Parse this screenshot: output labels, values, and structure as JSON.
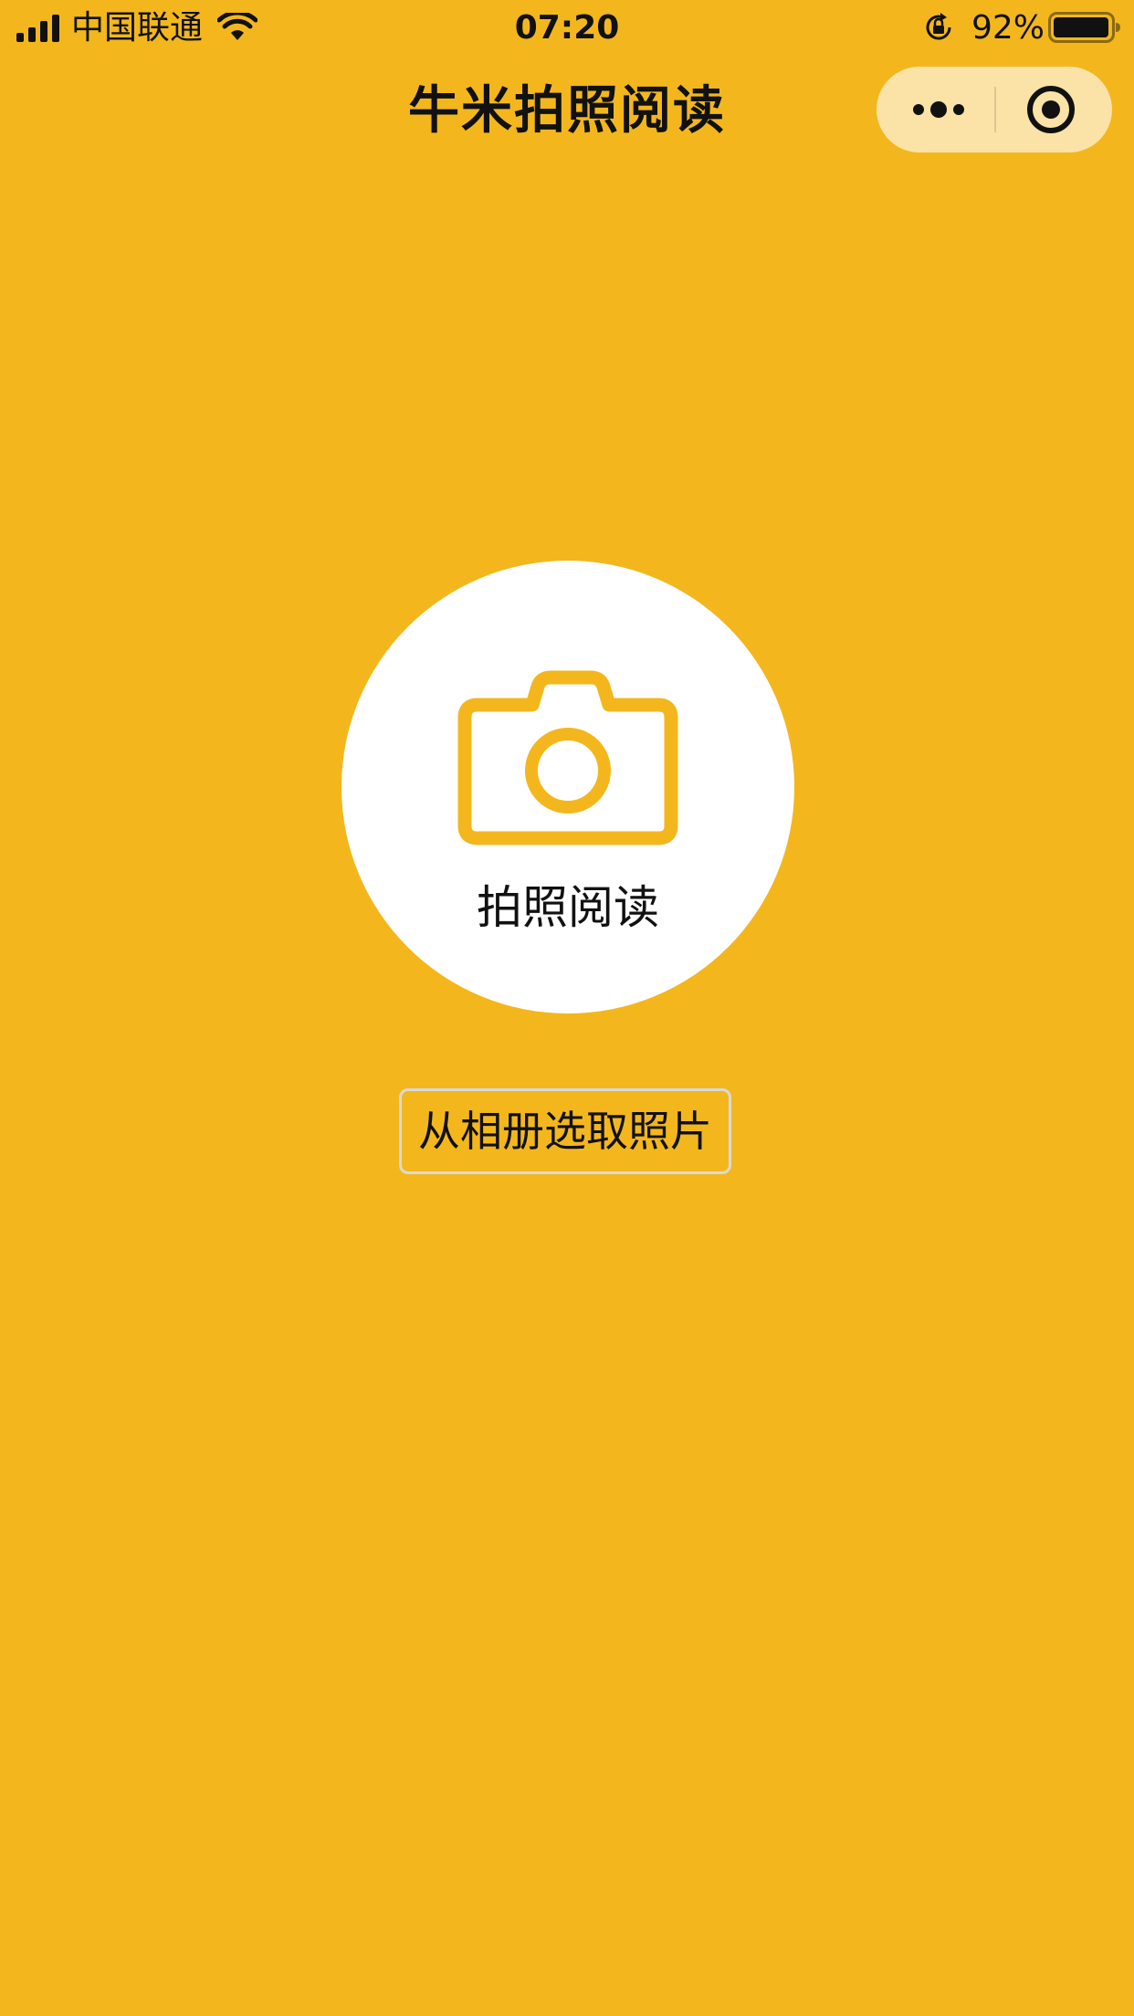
{
  "status_bar": {
    "carrier": "中国联通",
    "time": "07:20",
    "battery_percent": "92%",
    "icons": [
      "signal-icon",
      "wifi-icon",
      "rotation-lock-icon",
      "battery-icon"
    ]
  },
  "nav_bar": {
    "title": "牛米拍照阅读",
    "capsule_icons": [
      "more-icon",
      "close-target-icon"
    ]
  },
  "main": {
    "camera_button_label": "拍照阅读",
    "album_button_label": "从相册选取照片"
  },
  "colors": {
    "background": "#F3B71D",
    "accent": "#F3B71D",
    "capsule": "#FBE2A6",
    "circle": "#FFFFFF"
  }
}
